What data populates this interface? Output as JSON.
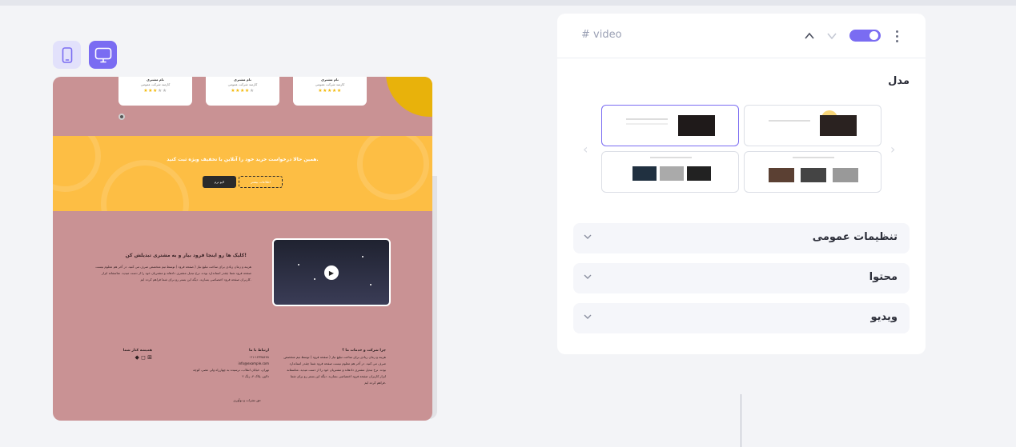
{
  "colors": {
    "accent": "#7a6cf2",
    "preview_bg": "#c99294",
    "cta_bg": "#fdbe44"
  },
  "device_switch": {
    "mobile_icon": "mobile-icon",
    "desktop_icon": "desktop-icon",
    "selected": "desktop"
  },
  "preview": {
    "cards": [
      {
        "name": "نام مشتری",
        "role": "کارمند شرکت عمومی",
        "rating": 3
      },
      {
        "name": "نام مشتری",
        "role": "کارمند شرکت عمومی",
        "rating": 4
      },
      {
        "name": "نام مشتری",
        "role": "کارمند شرکت عمومی",
        "rating": 5
      }
    ],
    "cta": {
      "title": "همین حالا درخواست خرید خود را آنلاین با تخفیف ویژه ثبت کنید.",
      "primary_button": "لایو ترم",
      "secondary_button": "اطلاعات بیشتر"
    },
    "video_section": {
      "title": "کلیک ها رو اینجا فرود بیار و به مشتری تبدیلش کن!",
      "text": "هزینه و زمان زیادی برای ساخت تبلیغ نیاز ( صفحه فرود ) توسط تیم متخصص صرف می کنید. در آخر هم معلوم نیست صفحه فرود شما چقدر استاندارد بوده. نرخ تبدیل مشتری دادهاند و مشتریان خود را از دست میدید. متاسفانه ابزار کاربران صفحه فرود اختصاصی بسازید. دیگه این بستر رو برای شما فراهم کرده ایم."
    },
    "footer": {
      "why_title": "چرا شرکت و خدمات ما ؟",
      "why_text": "هزینه و زمان زیادی برای ساخت تبلیغ نیاز ( صفحه فرود ) توسط تیم متخصص صرف می کنید. در آخر هم معلوم نیست صفحه فرود شما چقدر استاندارد بوده. نرخ تبدیل مشتری دادهاند و مشتریان خود را از دست میدید. متاسفانه ابزار کاربران صفحه فرود اختصاصی بسازید. دیگه این بستر رو برای شما فراهم کرده ایم.",
      "contact_title": "ارتباط با ما",
      "phone": "۰۲۱-۱۲۳۴۵۶۷۸",
      "email": "info@example.com",
      "address": "تهران، خیابان انقلاب، نرسیده به چهارراه ولی عصر، کوچه دلاور، پلاک ۴، زنگ ۲",
      "social_title": "همیشه کنار شما",
      "copyright": "حق نشرات و نوآوری"
    }
  },
  "panel": {
    "widget_name": "# video",
    "model_label": "مدل",
    "accordions": [
      {
        "label": "تنظیمات عمومی"
      },
      {
        "label": "محتوا"
      },
      {
        "label": "ویدیو"
      }
    ]
  }
}
